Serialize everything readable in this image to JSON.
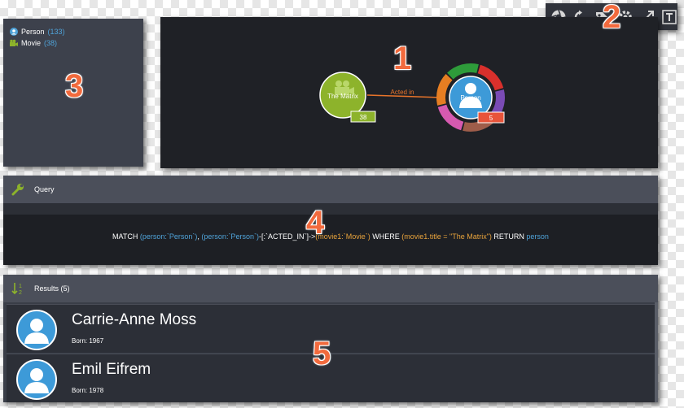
{
  "markers": [
    "1",
    "2",
    "3",
    "4",
    "5"
  ],
  "legend": {
    "items": [
      {
        "label": "Person",
        "count": "(133)",
        "icon": "person-icon",
        "color": "#4fa3d9"
      },
      {
        "label": "Movie",
        "count": "(38)",
        "icon": "movie-icon",
        "color": "#8db32b"
      }
    ]
  },
  "toolbar": {
    "icons": [
      "camera-shutter-icon",
      "refresh-icon",
      "tag-icon",
      "gear-icon",
      "expand-icon",
      "text-icon"
    ]
  },
  "graph": {
    "movie_node": {
      "label": "The Matrix",
      "count": "38",
      "color": "#8db32b"
    },
    "person_node": {
      "label": "Person",
      "count": "5",
      "color": "#3d9ad8"
    },
    "edge_label": "Acted in",
    "edge_color": "#e8742a",
    "ring_colors": [
      "#2e9b3a",
      "#d9302c",
      "#7a4bb5",
      "#9e5d4a",
      "#d65ab0",
      "#e67e22"
    ]
  },
  "query": {
    "title": "Query",
    "parts": [
      {
        "t": "MATCH ",
        "c": "kw"
      },
      {
        "t": "(person:`Person`)",
        "c": "bl"
      },
      {
        "t": ", ",
        "c": "kw"
      },
      {
        "t": "(person:`Person`)",
        "c": "bl"
      },
      {
        "t": "-[:`ACTED_IN`]->",
        "c": "kw"
      },
      {
        "t": "(movie1:`Movie`)",
        "c": "or"
      },
      {
        "t": " WHERE ",
        "c": "kw"
      },
      {
        "t": "(movie1.title = \"The Matrix\")",
        "c": "or"
      },
      {
        "t": " RETURN ",
        "c": "kw"
      },
      {
        "t": "person",
        "c": "bl"
      }
    ]
  },
  "results": {
    "title": "Results (5)",
    "rows": [
      {
        "name": "Carrie-Anne Moss",
        "born": "Born: 1967"
      },
      {
        "name": "Emil Eifrem",
        "born": "Born: 1978"
      }
    ]
  }
}
